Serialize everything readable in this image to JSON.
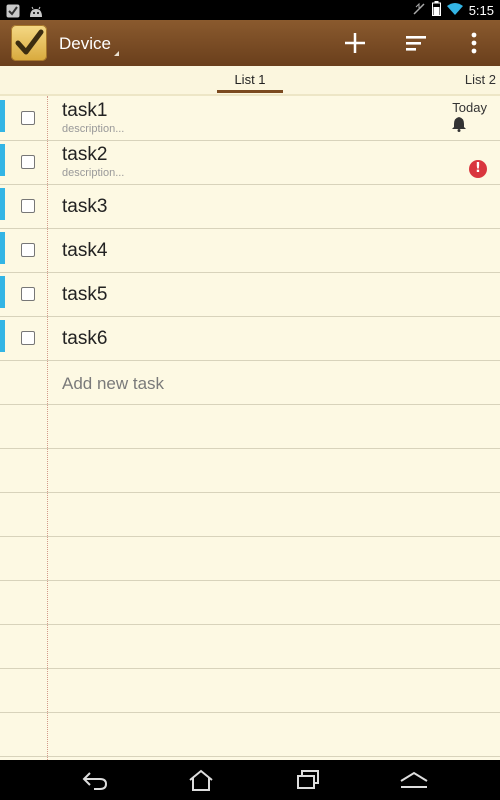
{
  "status_bar": {
    "time": "5:15"
  },
  "action_bar": {
    "account": "Device",
    "icons": [
      "checkbox-app-icon",
      "add-icon",
      "sort-icon",
      "overflow-menu-icon"
    ]
  },
  "tabs": [
    {
      "label": "List 1",
      "selected": true
    },
    {
      "label": "List 2",
      "selected": false
    }
  ],
  "tasks": [
    {
      "name": "task1",
      "description": "description...",
      "due": "Today",
      "reminder": true,
      "priority_alert": false
    },
    {
      "name": "task2",
      "description": "description...",
      "due": "",
      "reminder": false,
      "priority_alert": true
    },
    {
      "name": "task3",
      "description": ""
    },
    {
      "name": "task4",
      "description": ""
    },
    {
      "name": "task5",
      "description": ""
    },
    {
      "name": "task6",
      "description": ""
    }
  ],
  "add_new_placeholder": "Add new task",
  "colors": {
    "action_bar": "#7a4c24",
    "paper": "#fdf9e3",
    "task_stripe": "#33b5e5",
    "alert": "#d9363e",
    "tab_indicator": "#7b4a1f"
  }
}
